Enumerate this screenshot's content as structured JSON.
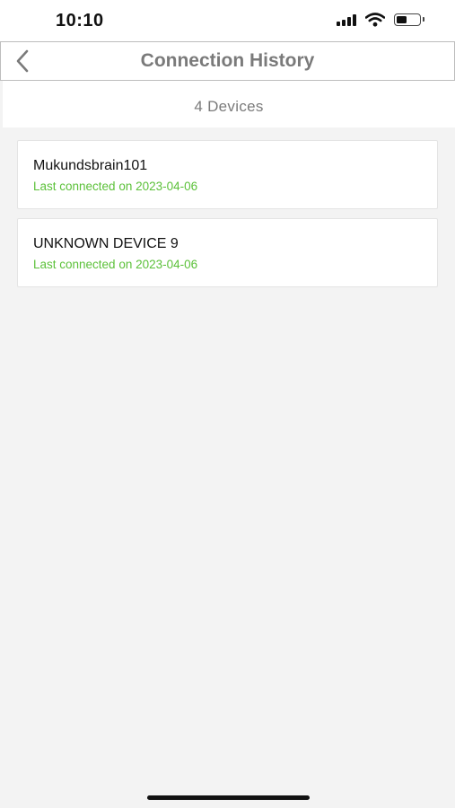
{
  "status_bar": {
    "time": "10:10",
    "icons": [
      "signal-icon",
      "wifi-icon",
      "battery-icon"
    ]
  },
  "nav": {
    "back_icon": "chevron-left-icon",
    "title": "Connection History"
  },
  "header": {
    "device_count": "4 Devices"
  },
  "devices": [
    {
      "name": "Mukundsbrain101",
      "status": "Last connected on 2023-04-06"
    },
    {
      "name": "UNKNOWN DEVICE 9",
      "status": "Last connected on 2023-04-06"
    }
  ],
  "colors": {
    "status_green": "#5cc13a",
    "title_gray": "#7a7a7a",
    "background": "#f3f3f3"
  }
}
